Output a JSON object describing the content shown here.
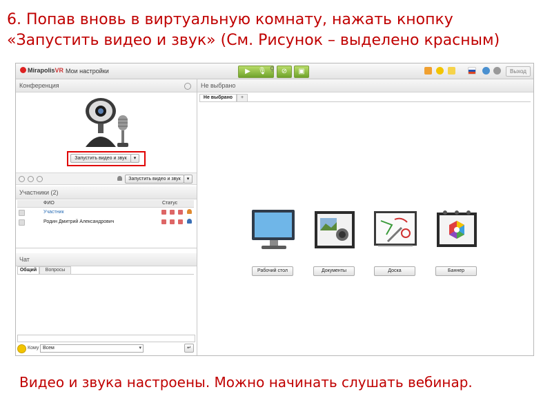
{
  "slide": {
    "title": "6. Попав вновь в виртуальную комнату, нажать кнопку «Запустить видео и звук» (См. Рисунок – выделено красным)",
    "caption": "Видео и звука настроены. Можно начинать  слушать вебинар."
  },
  "app": {
    "logo": "MirapolisVR",
    "logo_main": "Mirapolis",
    "logo_suffix": "VR",
    "menu_settings": "Мои настройки",
    "exit_label": "Выход",
    "colors": {
      "accent_red": "#c00000",
      "control_green": "#7fb136"
    }
  },
  "conference": {
    "header": "Конференция",
    "start_av_button": "Запустить видео и звук",
    "start_av_button_secondary": "Запустить видео и звук"
  },
  "participants": {
    "header": "Участники (2)",
    "columns": [
      "ФИО",
      "Статус"
    ],
    "rows": [
      {
        "name": "Участник"
      },
      {
        "name": "Родин Дмитрий Александрович"
      }
    ]
  },
  "chat": {
    "header": "Чат",
    "tabs": [
      "Общий",
      "Вопросы"
    ],
    "to_label": "Кому",
    "to_value": "Всем"
  },
  "workspace": {
    "header": "Не выбрано",
    "tab_label": "Не выбрано",
    "tab_add": "+",
    "tools": [
      {
        "label": "Рабочий стол",
        "icon": "monitor-icon"
      },
      {
        "label": "Документы",
        "icon": "documents-icon"
      },
      {
        "label": "Доска",
        "icon": "whiteboard-icon"
      },
      {
        "label": "Баннер",
        "icon": "banner-icon"
      }
    ]
  }
}
